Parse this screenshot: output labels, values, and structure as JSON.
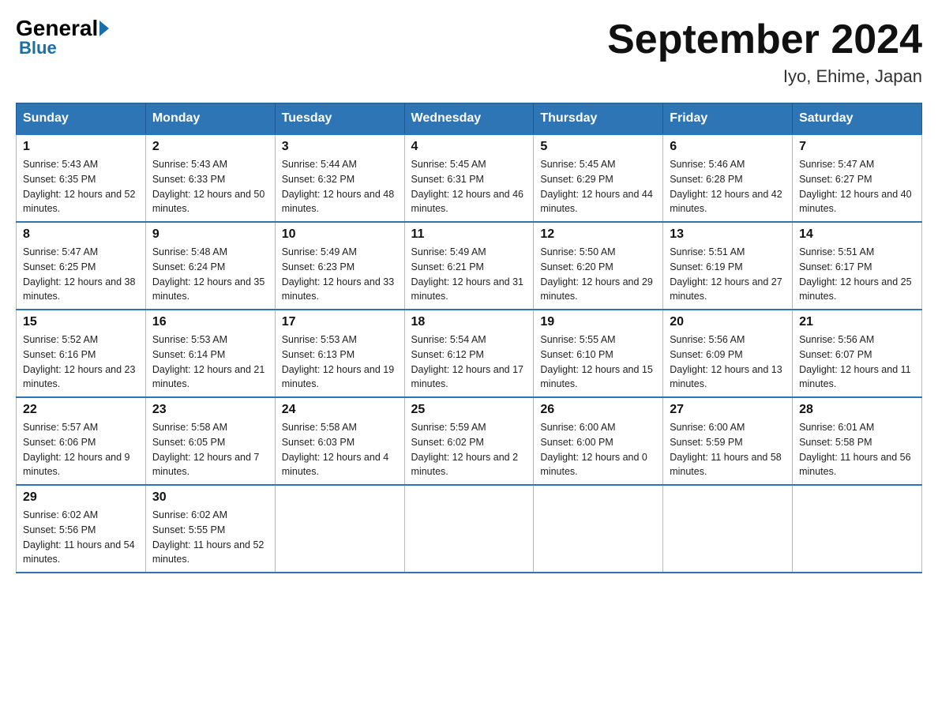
{
  "logo": {
    "general": "General",
    "blue": "Blue"
  },
  "header": {
    "title": "September 2024",
    "location": "Iyo, Ehime, Japan"
  },
  "days_of_week": [
    "Sunday",
    "Monday",
    "Tuesday",
    "Wednesday",
    "Thursday",
    "Friday",
    "Saturday"
  ],
  "weeks": [
    [
      {
        "day": "1",
        "sunrise": "5:43 AM",
        "sunset": "6:35 PM",
        "daylight": "12 hours and 52 minutes."
      },
      {
        "day": "2",
        "sunrise": "5:43 AM",
        "sunset": "6:33 PM",
        "daylight": "12 hours and 50 minutes."
      },
      {
        "day": "3",
        "sunrise": "5:44 AM",
        "sunset": "6:32 PM",
        "daylight": "12 hours and 48 minutes."
      },
      {
        "day": "4",
        "sunrise": "5:45 AM",
        "sunset": "6:31 PM",
        "daylight": "12 hours and 46 minutes."
      },
      {
        "day": "5",
        "sunrise": "5:45 AM",
        "sunset": "6:29 PM",
        "daylight": "12 hours and 44 minutes."
      },
      {
        "day": "6",
        "sunrise": "5:46 AM",
        "sunset": "6:28 PM",
        "daylight": "12 hours and 42 minutes."
      },
      {
        "day": "7",
        "sunrise": "5:47 AM",
        "sunset": "6:27 PM",
        "daylight": "12 hours and 40 minutes."
      }
    ],
    [
      {
        "day": "8",
        "sunrise": "5:47 AM",
        "sunset": "6:25 PM",
        "daylight": "12 hours and 38 minutes."
      },
      {
        "day": "9",
        "sunrise": "5:48 AM",
        "sunset": "6:24 PM",
        "daylight": "12 hours and 35 minutes."
      },
      {
        "day": "10",
        "sunrise": "5:49 AM",
        "sunset": "6:23 PM",
        "daylight": "12 hours and 33 minutes."
      },
      {
        "day": "11",
        "sunrise": "5:49 AM",
        "sunset": "6:21 PM",
        "daylight": "12 hours and 31 minutes."
      },
      {
        "day": "12",
        "sunrise": "5:50 AM",
        "sunset": "6:20 PM",
        "daylight": "12 hours and 29 minutes."
      },
      {
        "day": "13",
        "sunrise": "5:51 AM",
        "sunset": "6:19 PM",
        "daylight": "12 hours and 27 minutes."
      },
      {
        "day": "14",
        "sunrise": "5:51 AM",
        "sunset": "6:17 PM",
        "daylight": "12 hours and 25 minutes."
      }
    ],
    [
      {
        "day": "15",
        "sunrise": "5:52 AM",
        "sunset": "6:16 PM",
        "daylight": "12 hours and 23 minutes."
      },
      {
        "day": "16",
        "sunrise": "5:53 AM",
        "sunset": "6:14 PM",
        "daylight": "12 hours and 21 minutes."
      },
      {
        "day": "17",
        "sunrise": "5:53 AM",
        "sunset": "6:13 PM",
        "daylight": "12 hours and 19 minutes."
      },
      {
        "day": "18",
        "sunrise": "5:54 AM",
        "sunset": "6:12 PM",
        "daylight": "12 hours and 17 minutes."
      },
      {
        "day": "19",
        "sunrise": "5:55 AM",
        "sunset": "6:10 PM",
        "daylight": "12 hours and 15 minutes."
      },
      {
        "day": "20",
        "sunrise": "5:56 AM",
        "sunset": "6:09 PM",
        "daylight": "12 hours and 13 minutes."
      },
      {
        "day": "21",
        "sunrise": "5:56 AM",
        "sunset": "6:07 PM",
        "daylight": "12 hours and 11 minutes."
      }
    ],
    [
      {
        "day": "22",
        "sunrise": "5:57 AM",
        "sunset": "6:06 PM",
        "daylight": "12 hours and 9 minutes."
      },
      {
        "day": "23",
        "sunrise": "5:58 AM",
        "sunset": "6:05 PM",
        "daylight": "12 hours and 7 minutes."
      },
      {
        "day": "24",
        "sunrise": "5:58 AM",
        "sunset": "6:03 PM",
        "daylight": "12 hours and 4 minutes."
      },
      {
        "day": "25",
        "sunrise": "5:59 AM",
        "sunset": "6:02 PM",
        "daylight": "12 hours and 2 minutes."
      },
      {
        "day": "26",
        "sunrise": "6:00 AM",
        "sunset": "6:00 PM",
        "daylight": "12 hours and 0 minutes."
      },
      {
        "day": "27",
        "sunrise": "6:00 AM",
        "sunset": "5:59 PM",
        "daylight": "11 hours and 58 minutes."
      },
      {
        "day": "28",
        "sunrise": "6:01 AM",
        "sunset": "5:58 PM",
        "daylight": "11 hours and 56 minutes."
      }
    ],
    [
      {
        "day": "29",
        "sunrise": "6:02 AM",
        "sunset": "5:56 PM",
        "daylight": "11 hours and 54 minutes."
      },
      {
        "day": "30",
        "sunrise": "6:02 AM",
        "sunset": "5:55 PM",
        "daylight": "11 hours and 52 minutes."
      },
      null,
      null,
      null,
      null,
      null
    ]
  ]
}
